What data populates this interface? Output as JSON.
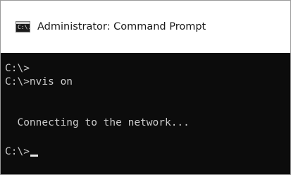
{
  "window": {
    "title": "Administrator: Command Prompt",
    "icon": "cmd-app-icon",
    "icon_glyph": "C:\\."
  },
  "console": {
    "lines": [
      "C:\\>",
      "C:\\>nvis on",
      "",
      "  Connecting to the network...",
      "",
      "C:\\>"
    ],
    "text_color": "#cccccc",
    "background_color": "#0c0c0c"
  }
}
